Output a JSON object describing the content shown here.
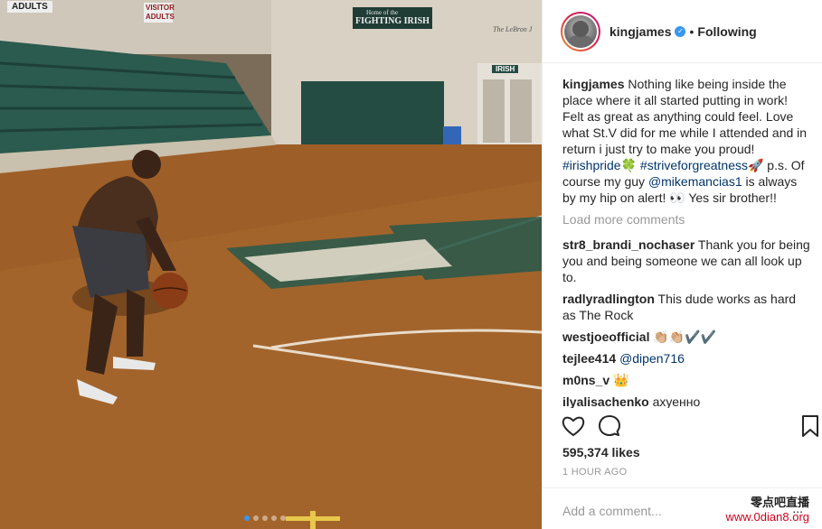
{
  "photo": {
    "signs": [
      "ADULTS",
      "VISITOR ADULTS",
      "Home of the",
      "FIGHTING IRISH",
      "The LeBron J",
      "IRISH"
    ],
    "carousel_total": 5,
    "carousel_active": 1
  },
  "post": {
    "username": "kingjames",
    "separator": "•",
    "follow_status": "Following",
    "caption": {
      "user": "kingjames",
      "text_1": " Nothing like being inside the place where it all started putting in work! Felt as great as anything could feel. Love what St.V did for me while I attended and in return i just try to make you proud! ",
      "tag_1": "#irishpride",
      "emoji_1": "🍀",
      "text_2": " ",
      "tag_2": "#striveforgreatness",
      "emoji_2": "🚀",
      "text_3": " p.s. Of course my guy ",
      "mention": "@mikemancias1",
      "text_4": " is always by my hip on alert! 👀 Yes sir brother!!"
    },
    "load_more": "Load more comments",
    "comments": [
      {
        "user": "str8_brandi_nochaser",
        "text": " Thank you for being you and being someone we can all look up to."
      },
      {
        "user": "radlyradlington",
        "text": " This dude works as hard as The Rock"
      },
      {
        "user": "westjoeofficial",
        "text": " 👏🏼👏🏼✔️✔️"
      },
      {
        "user": "tejlee414",
        "text": " ",
        "mention": "@dipen716"
      },
      {
        "user": "m0ns_v",
        "text": " 👑"
      },
      {
        "user": "ilyalisachenko",
        "text": " ахуенно"
      }
    ],
    "likes": "595,374 likes",
    "time": "1 HOUR AGO",
    "add_comment_placeholder": "Add a comment...",
    "more": "..."
  },
  "watermark": {
    "cn": "零点吧直播",
    "url": "www.0dian8.org"
  },
  "colors": {
    "link": "#003569",
    "muted": "#999999",
    "text": "#262626",
    "verified": "#3897f0"
  }
}
